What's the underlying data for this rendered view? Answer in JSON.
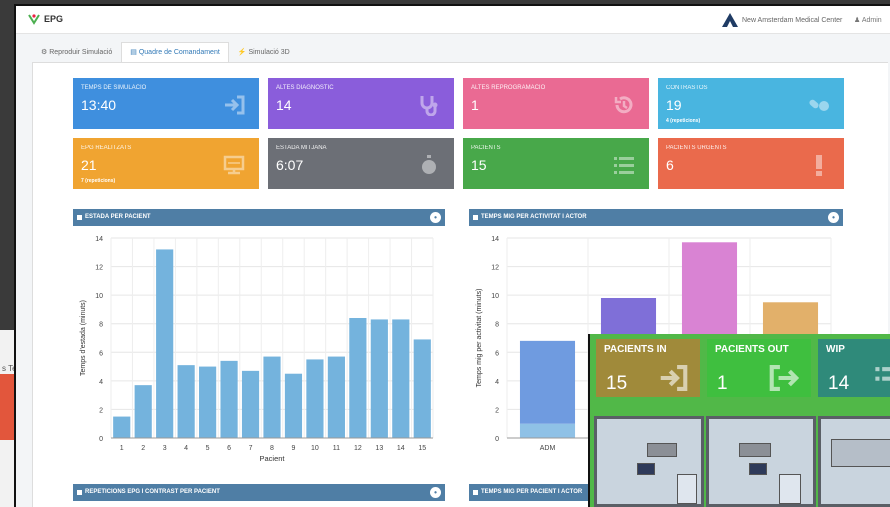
{
  "background_window": {
    "tab_text": "s Te"
  },
  "header": {
    "brand": "EPG",
    "center_name": "New Amsterdam Medical Center",
    "user": "Admin"
  },
  "tabs": [
    {
      "label": "Reproduir Simulació",
      "icon": "gear-icon"
    },
    {
      "label": "Quadre de Comandament",
      "icon": "chart-icon"
    },
    {
      "label": "Simulació 3D",
      "icon": "bolt-icon"
    }
  ],
  "stats": [
    {
      "label": "TEMPS DE SIMULACIÓ",
      "value": "13:40",
      "sub": "",
      "color": "#3f8fde",
      "icon": "sign-in-icon"
    },
    {
      "label": "ALTES DIAGNÒSTIC",
      "value": "14",
      "sub": "",
      "color": "#8a5ddb",
      "icon": "stethoscope-icon"
    },
    {
      "label": "ALTES REPROGRAMACIÓ",
      "value": "1",
      "sub": "",
      "color": "#ea6a93",
      "icon": "history-icon"
    },
    {
      "label": "CONTRASTOS",
      "value": "19",
      "sub": "4 (repeticions)",
      "color": "#49b5e0",
      "icon": "pills-icon"
    },
    {
      "label": "EPG REALITZATS",
      "value": "21",
      "sub": "7 (repeticions)",
      "color": "#f0a431",
      "icon": "monitor-icon"
    },
    {
      "label": "ESTADA MITJANA",
      "value": "6:07",
      "sub": "",
      "color": "#6c6f76",
      "icon": "stopwatch-icon"
    },
    {
      "label": "PACIENTS",
      "value": "15",
      "sub": "",
      "color": "#48a84a",
      "icon": "list-icon"
    },
    {
      "label": "PACIENTS URGENTS",
      "value": "6",
      "sub": "",
      "color": "#ea6a4c",
      "icon": "exclamation-icon"
    }
  ],
  "panels": {
    "estada": {
      "title": "ESTADA PER PACIENT"
    },
    "temps_activitat": {
      "title": "TEMPS MIG PER ACTIVITAT I ACTOR"
    },
    "repeticions": {
      "title": "REPETICIONS EPG I CONTRAST PER PACIENT"
    },
    "temps_pacient": {
      "title": "TEMPS MIG PER PACIENT I ACTOR"
    }
  },
  "chart_data": [
    {
      "type": "bar",
      "title": "ESTADA PER PACIENT",
      "xlabel": "Pacient",
      "ylabel": "Temps d'estada (minuts)",
      "ylim": [
        0,
        14
      ],
      "yticks": [
        0,
        2,
        4,
        6,
        8,
        10,
        12,
        14
      ],
      "categories": [
        "1",
        "2",
        "3",
        "4",
        "5",
        "6",
        "7",
        "8",
        "9",
        "10",
        "11",
        "12",
        "13",
        "14",
        "15"
      ],
      "values": [
        1.5,
        3.7,
        13.2,
        5.1,
        5.0,
        5.4,
        4.7,
        5.7,
        4.5,
        5.5,
        5.7,
        8.4,
        8.3,
        8.3,
        6.9
      ],
      "color": "#74b3dd",
      "grid": true
    },
    {
      "type": "bar",
      "title": "TEMPS MIG PER ACTIVITAT I ACTOR",
      "xlabel": "",
      "ylabel": "Temps mig per activitat (minuts)",
      "ylim": [
        0,
        14
      ],
      "yticks": [
        0,
        2,
        4,
        6,
        8,
        10,
        12,
        14
      ],
      "categories": [
        "ADM",
        "",
        "",
        ""
      ],
      "stacked": true,
      "series": [
        {
          "values": [
            1.0,
            0,
            0,
            0
          ],
          "color": "#8fc1e6"
        },
        {
          "values": [
            5.8,
            9.8,
            13.7,
            9.5
          ],
          "colors": [
            "#6f9be0",
            "#7f6fd8",
            "#d983d3",
            "#e2b06a"
          ]
        }
      ],
      "grid": true
    }
  ],
  "game": {
    "boxes": [
      {
        "label": "PACIENTS IN",
        "value": "15",
        "color": "#a08a3a",
        "icon": "sign-in-icon"
      },
      {
        "label": "PACIENTS OUT",
        "value": "1",
        "color": "#3fbf3f",
        "icon": "sign-out-icon"
      },
      {
        "label": "WIP",
        "value": "14",
        "color": "#2f8a7a",
        "icon": "list-icon"
      }
    ]
  }
}
